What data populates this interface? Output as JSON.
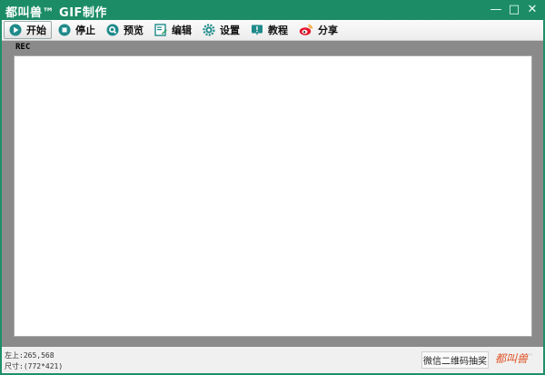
{
  "window": {
    "title": "都叫兽™ GIF制作",
    "controls": {
      "minimize": "—",
      "maximize": "□",
      "close": "✕"
    }
  },
  "toolbar": {
    "items": [
      {
        "label": "开始",
        "icon": "play-icon"
      },
      {
        "label": "停止",
        "icon": "stop-icon"
      },
      {
        "label": "预览",
        "icon": "preview-icon"
      },
      {
        "label": "编辑",
        "icon": "edit-icon"
      },
      {
        "label": "设置",
        "icon": "gear-icon"
      },
      {
        "label": "教程",
        "icon": "info-icon"
      },
      {
        "label": "分享",
        "icon": "weibo-icon"
      }
    ]
  },
  "stage": {
    "rec_label": "REC"
  },
  "status": {
    "position_label": "左上:",
    "position_value": "265,568",
    "size_label": "尺寸:",
    "size_value": "(772*421)",
    "lottery_button": "微信二维码抽奖",
    "logo_text": "都叫兽",
    "logo_tm": "™"
  },
  "colors": {
    "title_bar": "#1c8c67",
    "accent_teal": "#1f8a8a",
    "stage_gray": "#8a8a8a",
    "logo_orange": "#e0562a"
  }
}
